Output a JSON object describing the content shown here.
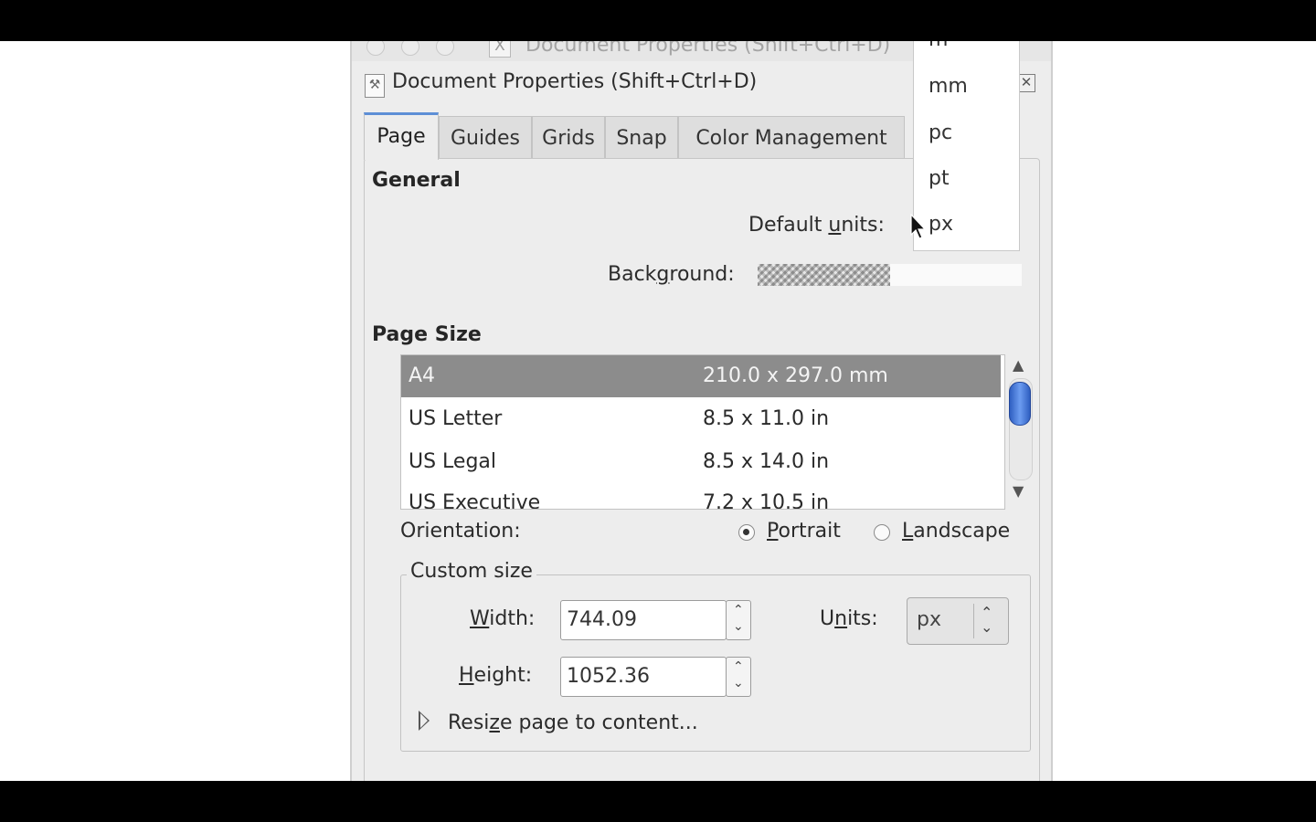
{
  "window": {
    "title_bar_text": "Document Properties (Shift+Ctrl+D)",
    "dock_title": "Document Properties (Shift+Ctrl+D)"
  },
  "tabs": [
    {
      "label": "Page",
      "active": true
    },
    {
      "label": "Guides",
      "active": false
    },
    {
      "label": "Grids",
      "active": false
    },
    {
      "label": "Snap",
      "active": false
    },
    {
      "label": "Color Management",
      "active": false
    }
  ],
  "general": {
    "section_title": "General",
    "default_units_label": "Default units:",
    "background_label": "Background:"
  },
  "page_size": {
    "section_title": "Page Size",
    "rows": [
      {
        "name": "A4",
        "size": "210.0 x 297.0 mm",
        "selected": true
      },
      {
        "name": "US Letter",
        "size": "8.5 x 11.0 in",
        "selected": false
      },
      {
        "name": "US Legal",
        "size": "8.5 x 14.0 in",
        "selected": false
      },
      {
        "name": "US Executive",
        "size": "7.2 x 10.5 in",
        "selected": false
      }
    ],
    "scroll_fraction": 0.0
  },
  "orientation": {
    "label": "Orientation:",
    "portrait_label": "Portrait",
    "landscape_label": "Landscape",
    "selected": "Portrait"
  },
  "custom_size": {
    "frame_label": "Custom size",
    "width_label": "Width:",
    "width_value": "744.09",
    "height_label": "Height:",
    "height_value": "1052.36",
    "units_label": "Units:",
    "units_value": "px",
    "resize_label": "Resize page to content..."
  },
  "units_popup": {
    "items": [
      "m",
      "mm",
      "pc",
      "pt",
      "px"
    ]
  },
  "icons": {
    "cursor": "arrow-cursor-icon",
    "close": "close-icon"
  }
}
